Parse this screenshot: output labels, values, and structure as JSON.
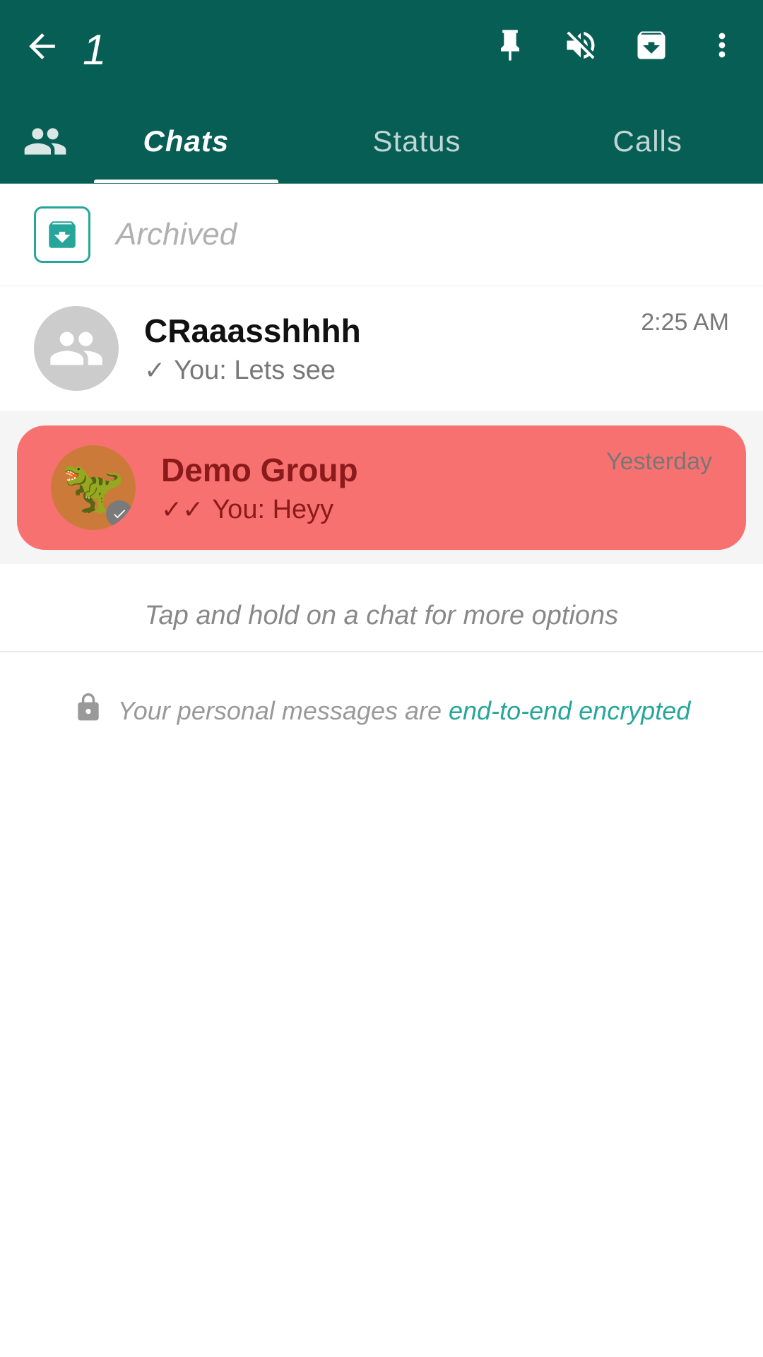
{
  "topBar": {
    "selectedCount": "1",
    "icons": {
      "pin": "📌",
      "mute": "🔇",
      "archive": "⬇"
    }
  },
  "tabs": [
    {
      "id": "chats",
      "label": "Chats",
      "active": true
    },
    {
      "id": "status",
      "label": "Status",
      "active": false
    },
    {
      "id": "calls",
      "label": "Calls",
      "active": false
    }
  ],
  "archived": {
    "label": "Archived"
  },
  "chats": [
    {
      "id": "chat1",
      "name": "CRaaasshhhh",
      "preview": "You: Lets see",
      "time": "2:25 AM",
      "selected": false,
      "isGroup": false,
      "tickType": "single"
    },
    {
      "id": "chat2",
      "name": "Demo Group",
      "preview": "You: Heyy",
      "time": "Yesterday",
      "selected": true,
      "isGroup": true,
      "tickType": "double"
    }
  ],
  "infoBar": {
    "text": "Tap and hold on a chat for more options"
  },
  "encryption": {
    "text": "Your personal messages are ",
    "linkText": "end-to-end encrypted"
  }
}
